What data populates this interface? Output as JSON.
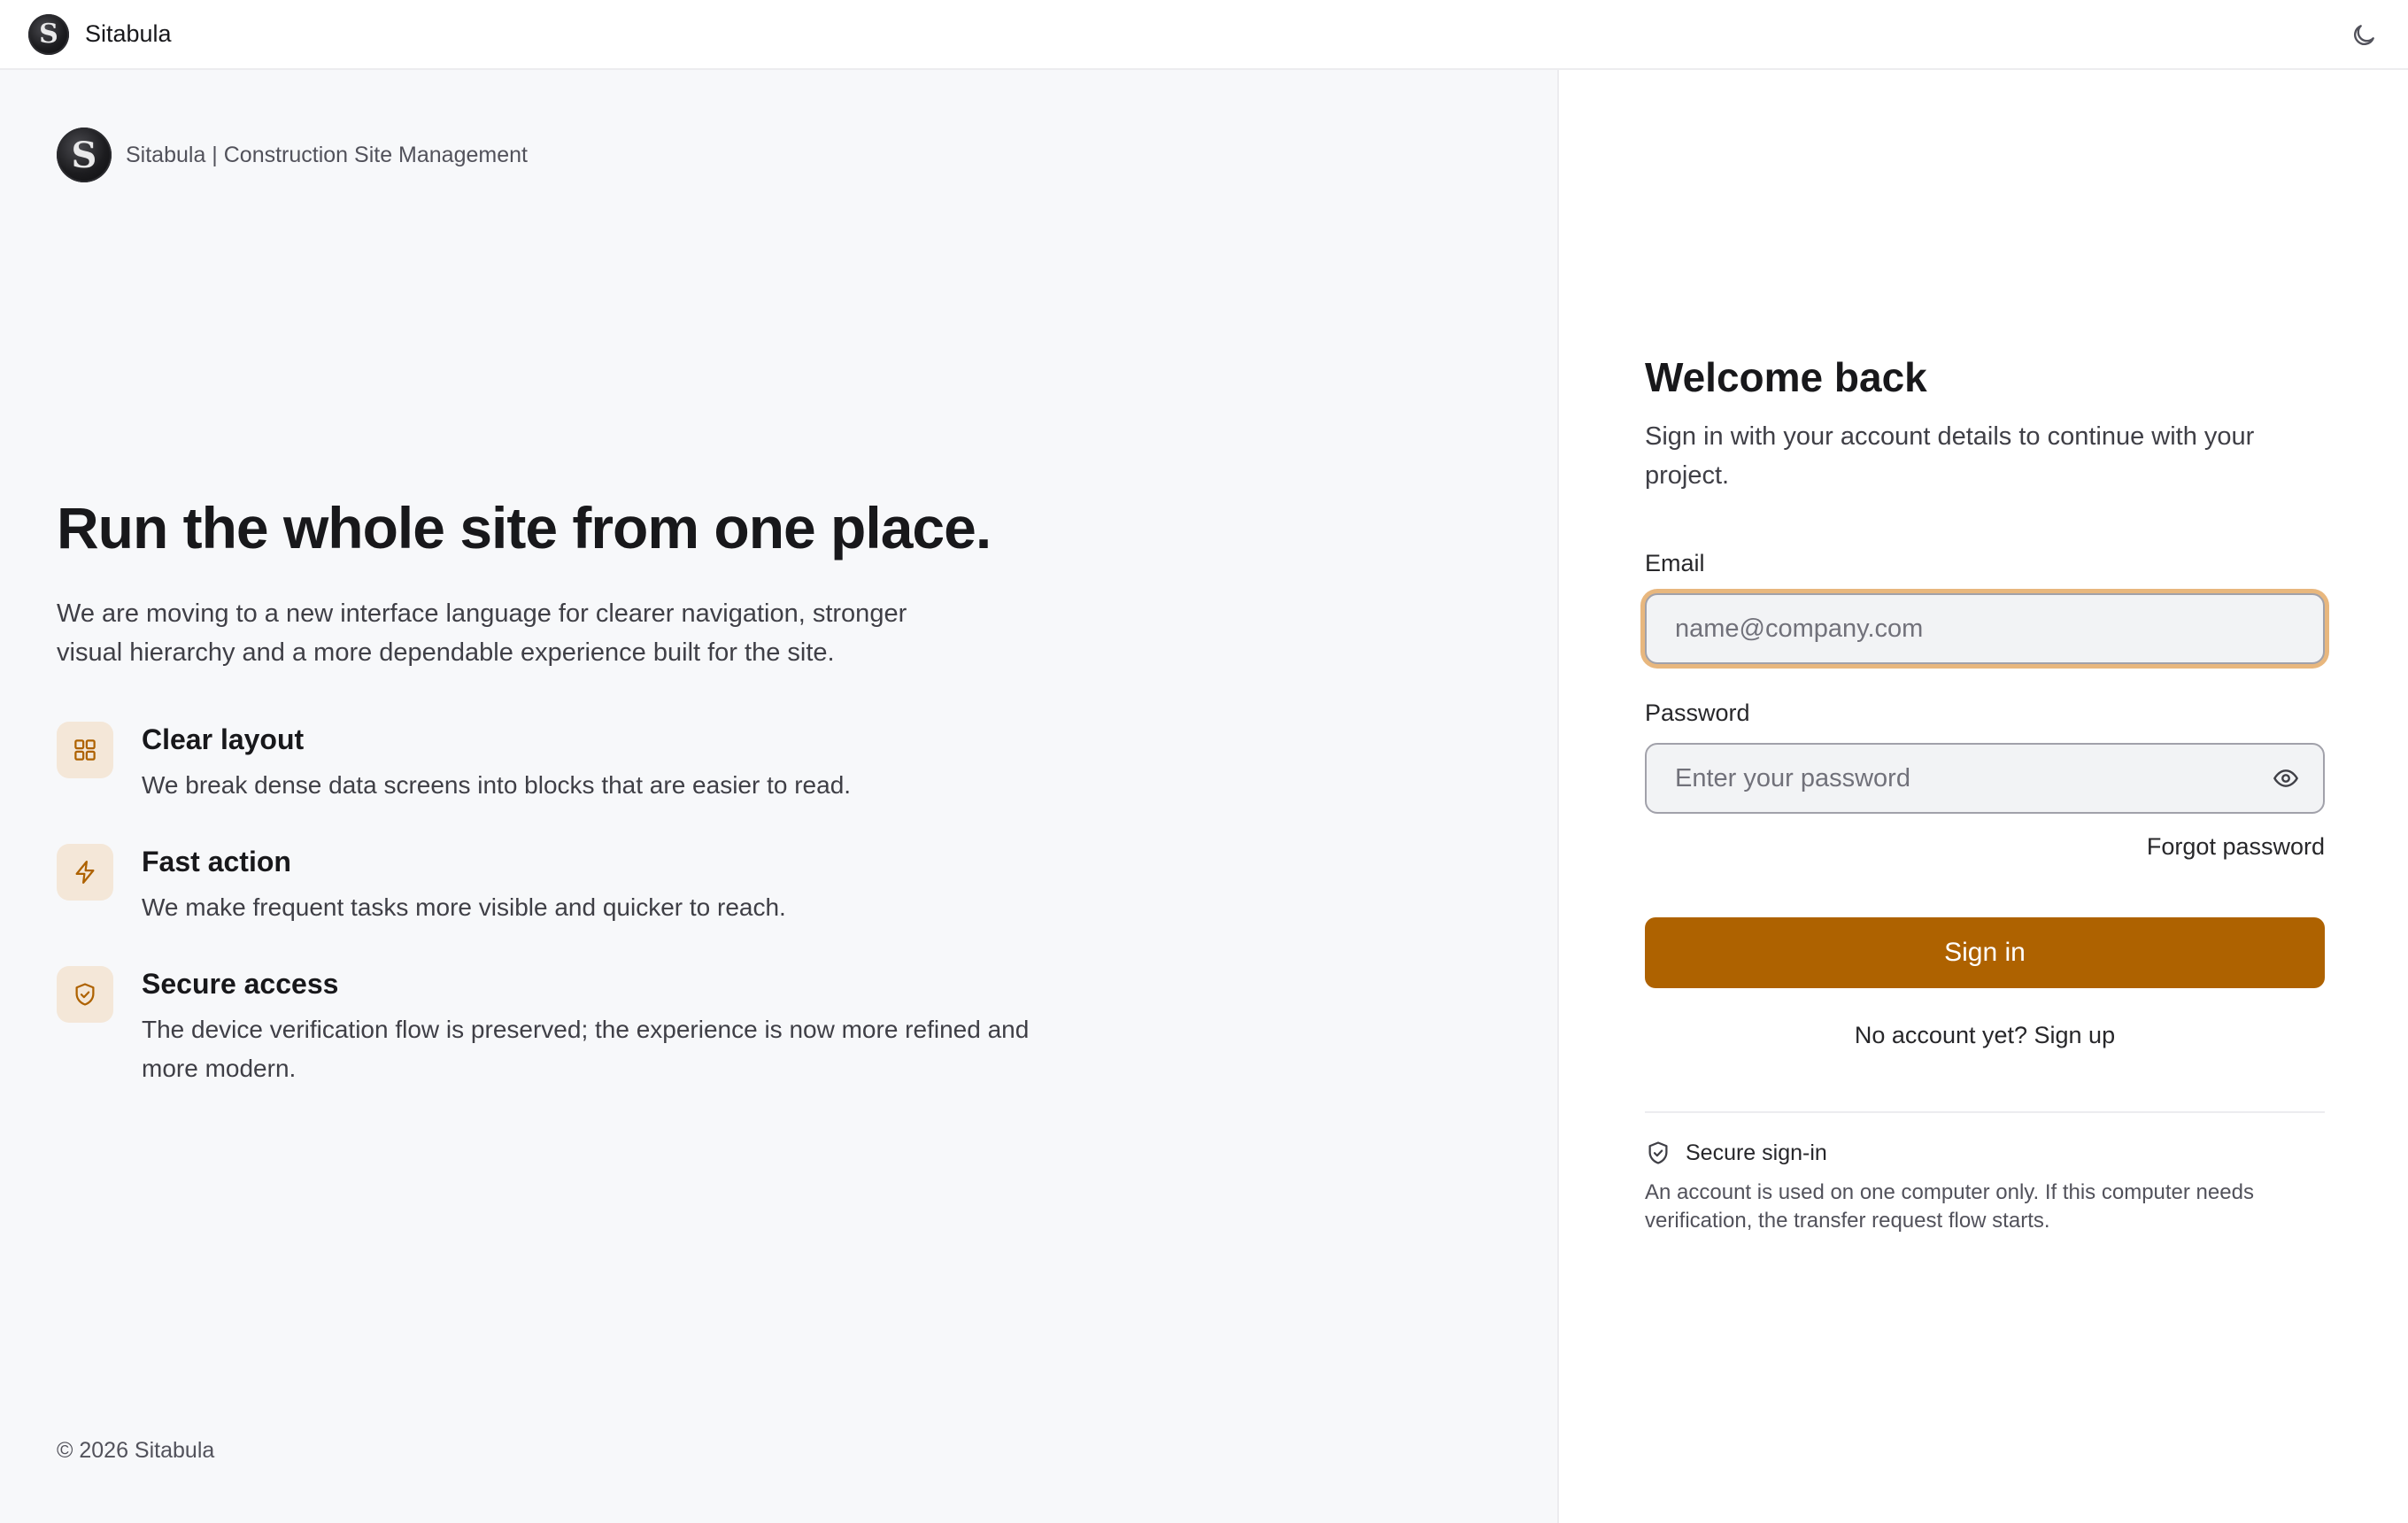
{
  "topbar": {
    "logo_letter": "S",
    "brand": "Sitabula"
  },
  "left": {
    "brand_text": "Sitabula | Construction Site Management",
    "headline": "Run the whole site from one place.",
    "lead": "We are moving to a new interface language for clearer navigation, stronger visual hierarchy and a more dependable experience built for the site.",
    "features": [
      {
        "icon": "grid-icon",
        "title": "Clear layout",
        "desc": "We break dense data screens into blocks that are easier to read."
      },
      {
        "icon": "lightning-icon",
        "title": "Fast action",
        "desc": "We make frequent tasks more visible and quicker to reach."
      },
      {
        "icon": "shield-check-icon",
        "title": "Secure access",
        "desc": "The device verification flow is preserved; the experience is now more refined and more modern."
      }
    ],
    "copyright": "© 2026 Sitabula"
  },
  "form": {
    "title": "Welcome back",
    "subtitle": "Sign in with your account details to continue with your project.",
    "email_label": "Email",
    "email_placeholder": "name@company.com",
    "email_value": "",
    "password_label": "Password",
    "password_placeholder": "Enter your password",
    "password_value": "",
    "forgot": "Forgot password",
    "submit": "Sign in",
    "signup": "No account yet? Sign up",
    "secure_title": "Secure sign-in",
    "secure_note": "An account is used on one computer only. If this computer needs verification, the transfer request flow starts."
  },
  "colors": {
    "accent": "#ae6200",
    "focus_ring": "#e8b77e",
    "icon_tile": "#f4e7d8",
    "left_bg": "#f7f8fa"
  }
}
